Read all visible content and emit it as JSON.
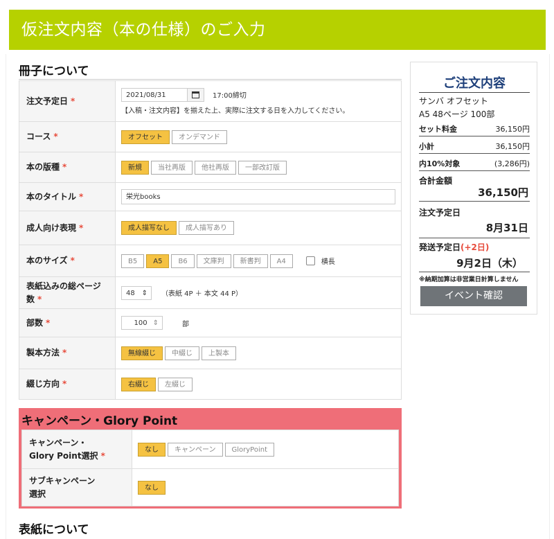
{
  "header": {
    "title": "仮注文内容（本の仕様）のご入力"
  },
  "section1": {
    "title": "冊子について"
  },
  "form": {
    "order_date": {
      "label": "注文予定日",
      "value": "2021/08/31",
      "deadline": "17:00締切",
      "note": "【入稿・注文内容】を揃えた上、実際に注文する日を入力してください。"
    },
    "course": {
      "label": "コース",
      "options": [
        "オフセット",
        "オンデマンド"
      ],
      "selected": "オフセット"
    },
    "edition": {
      "label": "本の版種",
      "options": [
        "新規",
        "当社再版",
        "他社再版",
        "一部改訂版"
      ],
      "selected": "新規"
    },
    "title": {
      "label": "本のタイトル",
      "value": "栄光books"
    },
    "adult": {
      "label": "成人向け表現",
      "options": [
        "成人描写なし",
        "成人描写あり"
      ],
      "selected": "成人描写なし"
    },
    "size": {
      "label": "本のサイズ",
      "options": [
        "B5",
        "A5",
        "B6",
        "文庫判",
        "新書判",
        "A4"
      ],
      "selected": "A5",
      "landscape_label": "横長"
    },
    "pages": {
      "label": "表紙込みの総ページ数",
      "value": "48",
      "note": "（表紙 4P ＋ 本文 44 P）"
    },
    "copies": {
      "label": "部数",
      "value": "100",
      "unit": "部"
    },
    "binding": {
      "label": "製本方法",
      "options": [
        "無線綴じ",
        "中綴じ",
        "上製本"
      ],
      "selected": "無線綴じ"
    },
    "direction": {
      "label": "綴じ方向",
      "options": [
        "右綴じ",
        "左綴じ"
      ],
      "selected": "右綴じ"
    }
  },
  "campaign": {
    "title": "キャンペーン・Glory Point",
    "select": {
      "label_line1": "キャンペーン・",
      "label_line2": "Glory Point選択",
      "options": [
        "なし",
        "キャンペーン",
        "GloryPoint"
      ],
      "selected": "なし"
    },
    "sub": {
      "label_line1": "サブキャンペーン",
      "label_line2": "選択",
      "options": [
        "なし"
      ],
      "selected": "なし"
    }
  },
  "sidebar": {
    "title": "ご注文内容",
    "product": "サンバ オフセット",
    "spec": "A5  48ページ  100部",
    "set_price_label": "セット料金",
    "set_price": "36,150円",
    "subtotal_label": "小計",
    "subtotal": "36,150円",
    "tax_label": "内10%対象",
    "tax": "(3,286円)",
    "total_label": "合計金額",
    "total": "36,150円",
    "order_date_label": "注文予定日",
    "order_date": "8月31日",
    "ship_label": "発送予定日",
    "ship_extra": "(+2日)",
    "ship_date": "9月2日（木）",
    "note": "※納期加算は非営業日計算しません",
    "event_button": "イベント確認"
  },
  "section2": {
    "title": "表紙について"
  },
  "required_mark": "*"
}
